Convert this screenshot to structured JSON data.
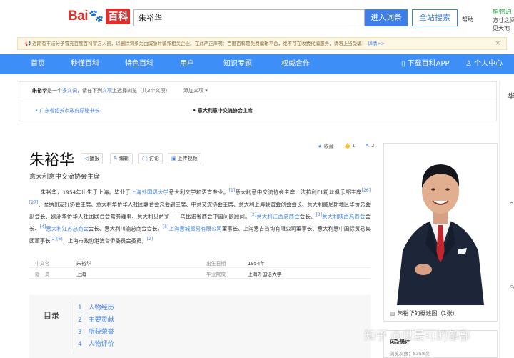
{
  "header": {
    "logo_bai": "Bai",
    "logo_du_icon": "paw-icon",
    "logo_baike": "百科",
    "search_value": "朱裕华",
    "enter_label": "进入词条",
    "search_all_label": "全站搜索",
    "help_label": "帮助",
    "promo_line1": "植物逍",
    "promo_line2": "方寸之间",
    "promo_line3": "见天地"
  },
  "notice": {
    "text": "近期有不法分子冒充百度百科官方人员，以删除词条为由威胁并骗诈相关企业。在此严正声明：百度百科是免费编辑平台，绝不存在收费代编服务，请勿上当受骗！",
    "link": "详情>>",
    "close": "×"
  },
  "nav": {
    "items": [
      "首页",
      "秒懂百科",
      "特色百科",
      "用户",
      "知识专题",
      "权威合作"
    ],
    "app_label": "下载百科APP",
    "user_label": "个人中心"
  },
  "polysemy": {
    "name": "朱裕华",
    "text_a": "是一个",
    "text_b": "多义词",
    "text_c": "，请在下列",
    "text_d": "义项",
    "text_e": "上选择浏览（共2个义项）",
    "add_label": "添加义项",
    "item_a": "广东省韶关市政府原秘书长",
    "item_b": "意大利意中交流协会主席"
  },
  "lemma": {
    "title": "朱裕华",
    "tools": [
      "播报",
      "编辑",
      "讨论",
      "上传视频"
    ],
    "subtitle": "意大利意中交流协会主席",
    "collect_label": "收藏",
    "like_count": "1",
    "share_count": "2"
  },
  "summary": {
    "p1": "朱裕华，1954年出生于上海。毕业于",
    "link1": "上海外国语大学",
    "p2": "意大利文学和语言专业。",
    "ref1": "[1]",
    "p3": "意大利意中交流协会主席、法拉利F1粉丝俱乐部主席",
    "ref2": "[26]",
    "ref3": "[27]",
    "p4": "、摩纳哥友好协会主席、意大利华侨华人社团联合会总会副主席、中意交流协会主席、意大利上海联谊会创会会长、意大利威尼斯地区华侨总会副会长、欧洲华侨华人社团联合会常务理事、意大利贝萨罗——乌比诺省商会中国问题顾问。",
    "ref4": "[2]",
    "link2": "意大利江西总商会",
    "p5": "会长、",
    "ref5": "[3]",
    "link3": "意大利陕西总商会",
    "p6": "会长、",
    "ref6": "[4]",
    "link4": "意大利江苏总商会",
    "p7": "会长、意大利川渝总商会会长。",
    "ref7": "[5]",
    "link5": "上海意城贸易有限公司",
    "p8": "董事长、上海意吉咨询有限公司董事长、意大利意中国际贸易集团董事长",
    "ref8": "[2]",
    "ref9": "[6]",
    "p9": "，上海市政协港澳台侨委员会委员。",
    "ref10": "[2]"
  },
  "info": {
    "rows": [
      {
        "k1": "中文名",
        "v1": "朱裕华",
        "k2": "出生日期",
        "v2": "1954年"
      },
      {
        "k1": "籍　贯",
        "v1": "上海",
        "k2": "毕业院校",
        "v2": "上海外国语大学"
      }
    ]
  },
  "toc": {
    "title": "目录",
    "items": [
      "1　人物经历",
      "2　主要贡献",
      "3　所获荣誉",
      "4　人物评价"
    ]
  },
  "photo": {
    "caption": "朱裕华的概述图（1张）",
    "card_title": "词条统计",
    "card_sub": "浏览次数：8358次"
  },
  "side": {
    "label": "华"
  },
  "watermark": "知乎 @世最可的邹部",
  "colors": {
    "accent": "#3e8ef7",
    "link": "#3e7ee8",
    "brand_red": "#de2f2f"
  }
}
